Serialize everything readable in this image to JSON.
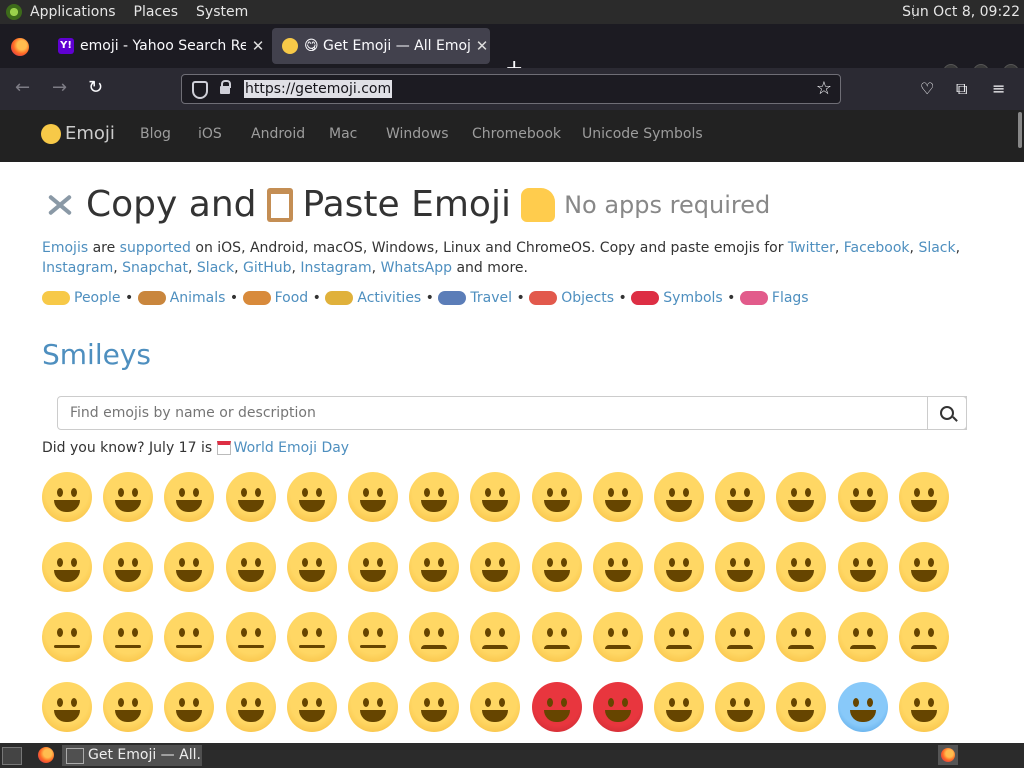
{
  "system_panel": {
    "menus": [
      "Applications",
      "Places",
      "System"
    ],
    "clock": "Sun Oct  8, 09:22"
  },
  "browser": {
    "tabs": [
      {
        "title": "emoji - Yahoo Search Results",
        "favicon": "yahoo-icon",
        "active": false
      },
      {
        "title": "😋 Get Emoji — All Emojis to ✂️ Copy and 📋 Paste 👍",
        "favicon": "emoji-face-icon",
        "active": true
      }
    ],
    "new_tab": "+",
    "tab_list": "⌄",
    "url": "https://getemoji.com",
    "icons": {
      "back": "←",
      "forward": "→",
      "reload": "↻",
      "star": "☆",
      "pocket": "♡",
      "extensions": "⧉",
      "menu": "≡"
    }
  },
  "site": {
    "brand": "Emoji",
    "nav": [
      "Blog",
      "iOS",
      "Android",
      "Mac",
      "Windows",
      "Chromebook",
      "Unicode Symbols"
    ],
    "hero": {
      "part1": "Copy and",
      "part2": "Paste Emoji",
      "tagline": "No apps required"
    },
    "intro": {
      "emojis": "Emojis",
      "are": " are ",
      "supported": "supported",
      "text1": " on iOS, Android, macOS, Windows, Linux and ChromeOS. Copy and paste emojis for ",
      "twitter": "Twitter",
      "facebook": "Facebook",
      "slack": "Slack",
      "instagram": "Instagram",
      "snapchat": "Snapchat",
      "slack2": "Slack",
      "github": "GitHub",
      "instagram2": "Instagram",
      "whatsapp": "WhatsApp",
      "more": " and more."
    },
    "categories": [
      {
        "label": "People",
        "color": "#f7c948"
      },
      {
        "label": "Animals",
        "color": "#c9863d"
      },
      {
        "label": "Food",
        "color": "#d88a3b"
      },
      {
        "label": "Activities",
        "color": "#e0b13b"
      },
      {
        "label": "Travel",
        "color": "#5b7db8"
      },
      {
        "label": "Objects",
        "color": "#e2594c"
      },
      {
        "label": "Symbols",
        "color": "#dd2e44"
      },
      {
        "label": "Flags",
        "color": "#e25b8b"
      }
    ],
    "section_title": "Smileys",
    "search_placeholder": "Find emojis by name or description",
    "did_you_know": {
      "text": "Did you know? July 17 is ",
      "link": "World Emoji Day"
    }
  },
  "taskbar": {
    "task_title": "Get Emoji — All..."
  }
}
